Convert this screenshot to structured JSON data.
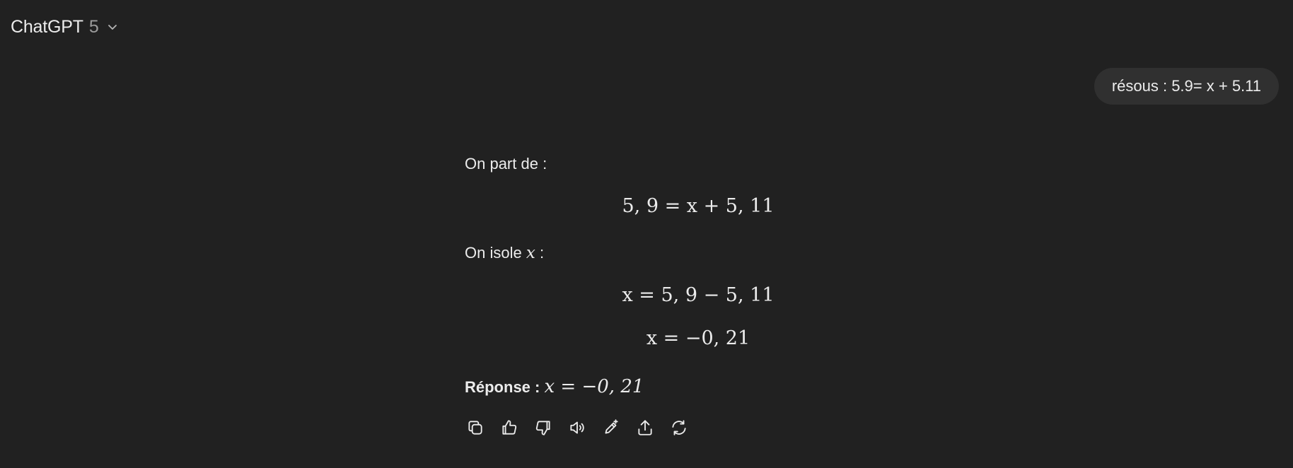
{
  "header": {
    "model_name": "ChatGPT",
    "model_version": "5",
    "dropdown_icon": "chevron-down-icon"
  },
  "user_message": {
    "text": "résous : 5.9= x + 5.11"
  },
  "assistant_message": {
    "intro": "On part de :",
    "equation1": "5, 9 = x + 5, 11",
    "isolate_prefix": "On isole",
    "isolate_var": "x",
    "isolate_suffix": " :",
    "equation2": "x = 5, 9 − 5, 11",
    "equation3": "x = −0, 21",
    "answer_label": "Réponse :",
    "answer_value": "x = −0, 21"
  },
  "actions": [
    {
      "name": "copy",
      "icon": "copy-icon"
    },
    {
      "name": "thumbs-up",
      "icon": "thumbs-up-icon"
    },
    {
      "name": "thumbs-down",
      "icon": "thumbs-down-icon"
    },
    {
      "name": "read-aloud",
      "icon": "speaker-icon"
    },
    {
      "name": "edit",
      "icon": "pencil-sparkle-icon"
    },
    {
      "name": "share",
      "icon": "share-icon"
    },
    {
      "name": "regenerate",
      "icon": "refresh-icon"
    }
  ],
  "colors": {
    "background": "#212121",
    "bubble": "#303030",
    "text": "#ececec",
    "muted": "#9b9b9b"
  }
}
